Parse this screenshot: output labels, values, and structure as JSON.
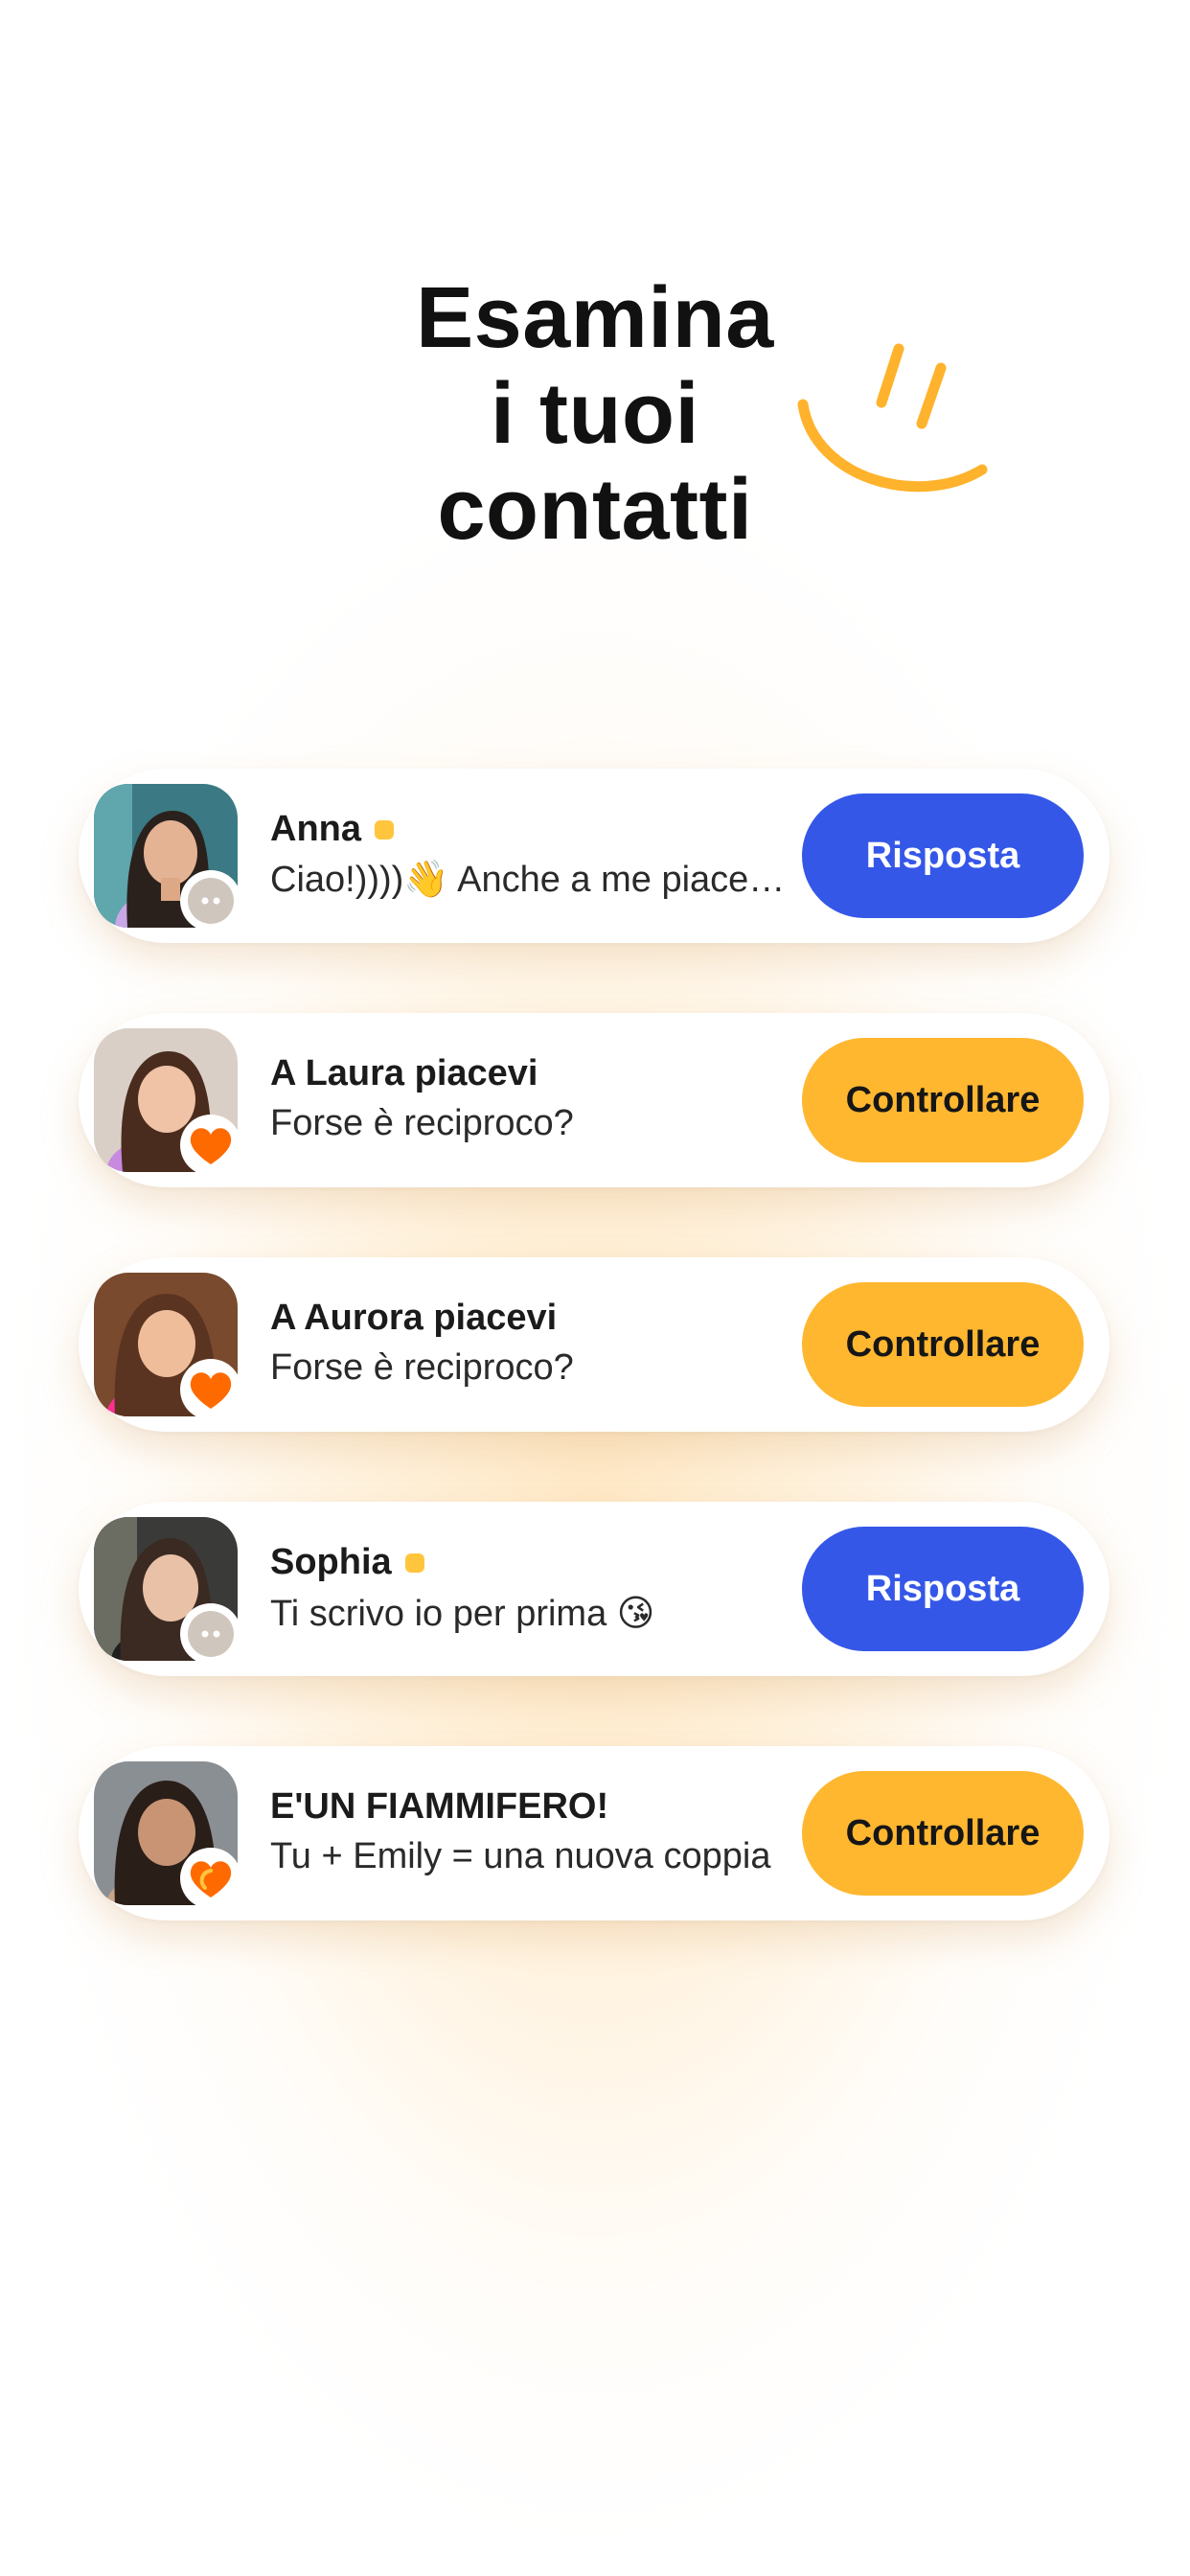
{
  "title": {
    "line1": "Esamina",
    "line2": "i tuoi",
    "line3": "contatti"
  },
  "colors": {
    "accent_blue": "#3557E8",
    "accent_yellow": "#FFB730",
    "heart_orange": "#FF6A00",
    "smile": "#FFB22C"
  },
  "contacts": [
    {
      "name": "Anna",
      "online": true,
      "message": "Ciao!))))👋 Anche a me piace....",
      "badge_icon": "chat-bubble-icon",
      "action": "Risposta"
    },
    {
      "name": "A Laura piacevi",
      "online": false,
      "message": "Forse è reciproco?",
      "badge_icon": "heart-icon",
      "action": "Controllare"
    },
    {
      "name": "A Aurora piacevi",
      "online": false,
      "message": "Forse è reciproco?",
      "badge_icon": "heart-icon",
      "action": "Controllare"
    },
    {
      "name": "Sophia",
      "online": true,
      "message": "Ti scrivo io per prima 😘",
      "badge_icon": "chat-bubble-icon",
      "action": "Risposta"
    },
    {
      "name": "E'UN FIAMMIFERO!",
      "online": false,
      "message": "Tu + Emily = una nuova coppia",
      "badge_icon": "match-heart-icon",
      "action": "Controllare"
    }
  ]
}
